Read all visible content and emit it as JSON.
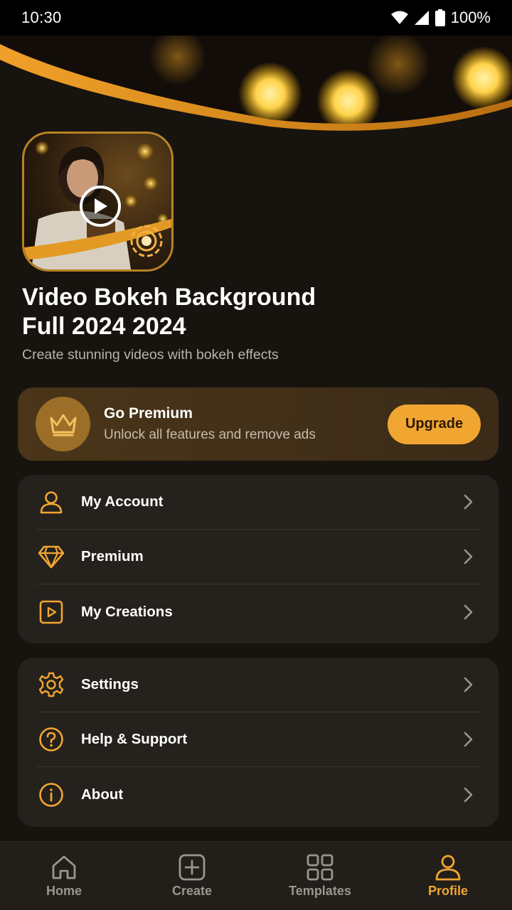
{
  "status": {
    "time": "10:30",
    "battery": "100%"
  },
  "app": {
    "title_line1": "Video Bokeh Background",
    "title_line2": "Full 2024 2024",
    "subtitle": "Create stunning videos with bokeh effects"
  },
  "premium": {
    "title": "Go Premium",
    "subtitle": "Unlock all features and remove ads",
    "button": "Upgrade"
  },
  "menu_group_1": [
    {
      "label": "My Account",
      "icon": "user-icon"
    },
    {
      "label": "Premium",
      "icon": "diamond-icon"
    },
    {
      "label": "My Creations",
      "icon": "play-square-icon"
    }
  ],
  "menu_group_2": [
    {
      "label": "Settings",
      "icon": "gear-icon"
    },
    {
      "label": "Help & Support",
      "icon": "help-circle-icon"
    },
    {
      "label": "About",
      "icon": "info-icon"
    }
  ],
  "bottom_nav": [
    {
      "label": "Home",
      "icon": "home-icon",
      "active": false
    },
    {
      "label": "Create",
      "icon": "plus-square-icon",
      "active": false
    },
    {
      "label": "Templates",
      "icon": "grid-icon",
      "active": false
    },
    {
      "label": "Profile",
      "icon": "user-icon",
      "active": true
    }
  ],
  "colors": {
    "accent": "#f1a631",
    "background": "#17130f",
    "card": "#25211d"
  }
}
